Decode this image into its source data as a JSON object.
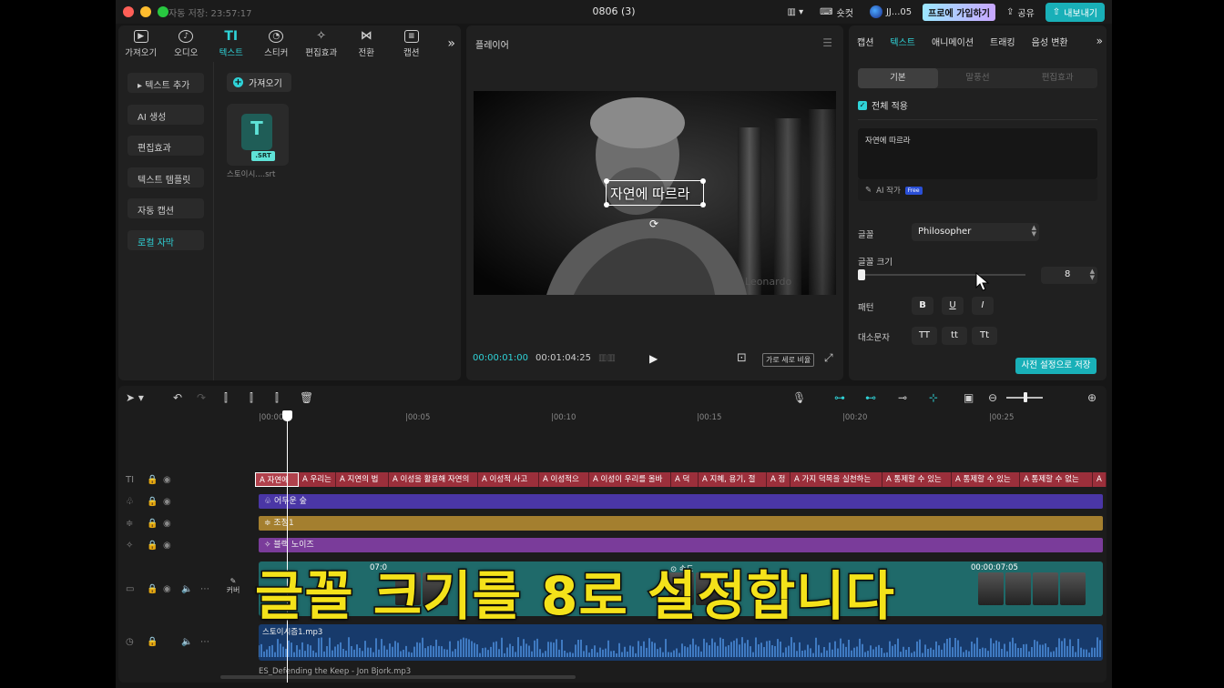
{
  "titlebar": {
    "autosave": "자동 저장: 23:57:17",
    "title": "0806 (3)",
    "shortcut_label": "숏컷",
    "user_name": "JJ...05",
    "pro_label": "프로에 가입하기",
    "share_label": "공유",
    "export_label": "내보내기"
  },
  "toolbar_tabs": [
    {
      "label": "가져오기",
      "icon": "import-icon"
    },
    {
      "label": "오디오",
      "icon": "audio-icon"
    },
    {
      "label": "텍스트",
      "icon": "text-icon"
    },
    {
      "label": "스티커",
      "icon": "sticker-icon"
    },
    {
      "label": "편집효과",
      "icon": "effects-icon"
    },
    {
      "label": "전환",
      "icon": "transition-icon"
    },
    {
      "label": "캡션",
      "icon": "caption-icon"
    }
  ],
  "side_menu": [
    "텍스트 추가",
    "AI 생성",
    "편집효과",
    "텍스트 템플릿",
    "자동 캡션",
    "로컬 자막"
  ],
  "media": {
    "import_label": "가져오기",
    "srt_icon_letter": "T",
    "srt_tag": ".SRT",
    "srt_name": "스토이시....srt"
  },
  "player": {
    "title": "플레이어",
    "caption_text": "자연에 따르라",
    "watermark": "Leonardo",
    "time_current": "00:00:01:00",
    "time_total": "00:01:04:25",
    "ratio_label": "가로 세로 비율"
  },
  "right_panel": {
    "tabs": [
      "캡션",
      "텍스트",
      "애니메이션",
      "트래킹",
      "음성 변환"
    ],
    "segments": [
      "기본",
      "말풍선",
      "편집효과"
    ],
    "apply_all": "전체 적용",
    "text_value": "자연에 따르라",
    "ai_write": "AI 작가",
    "free_tag": "Free",
    "font_label": "글꼴",
    "font_value": "Philosopher",
    "size_label": "글꼴 크기",
    "size_value": "8",
    "pattern_label": "패턴",
    "pattern_buttons": [
      "B",
      "U",
      "I"
    ],
    "case_label": "대소문자",
    "case_buttons": [
      "TT",
      "tt",
      "Tt"
    ],
    "preset_button": "사전 설정으로 저장"
  },
  "timeline": {
    "ruler": [
      "|00:00",
      "|00:05",
      "|00:10",
      "|00:15",
      "|00:20",
      "|00:25"
    ],
    "text_clips": [
      "A 자연에",
      "A 우리는",
      "A 지연의 법",
      "A 이성을 활용해 자연의",
      "A 이성적 사고",
      "A 이성적으",
      "A 이성이 우리를 올바",
      "A 덕",
      "A 지혜, 용기, 절",
      "A 정",
      "A 가지 덕목을 실천하는",
      "A 통제할 수 있는",
      "A 통제할 수 있는",
      "A 통제할 수 없는",
      "A"
    ],
    "effect_clip": "어두운 숲",
    "adjust_clip": "조정1",
    "filter_clip": "블랙 노이즈",
    "cover_label": "커버",
    "video_time_1": "07:0",
    "video_speed": "속도",
    "video_time_2": "00:00:07:05",
    "audio_clip": "스토이시즘1.mp3",
    "bottom_clip": "ES_Defending the Keep - Jon Bjork.mp3"
  },
  "overlay_caption": "글꼴 크기를 8로 설정합니다",
  "colors": {
    "accent": "#2fd3d8",
    "text_clip": "#9b2f3b",
    "effect_clip": "#4a36a6",
    "adjust_clip": "#a47f2f",
    "filter_clip": "#7a3c9a",
    "caption_yellow": "#f4e21a"
  }
}
